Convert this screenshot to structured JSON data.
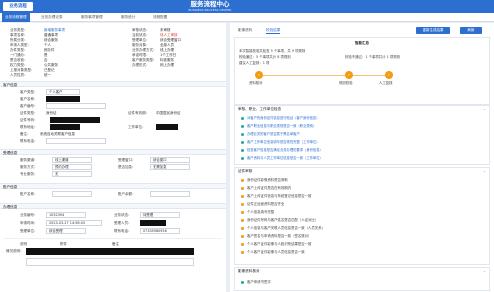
{
  "header": {
    "logo_text": "业务流程",
    "title": "服务流程中心",
    "subtitle": "BUSINESS PROCESS CENTER"
  },
  "tabs": [
    {
      "label": "业务流程管理"
    },
    {
      "label": "业务办理记录"
    },
    {
      "label": "服务事项管理"
    },
    {
      "label": "服务统计"
    },
    {
      "label": "流程配置"
    }
  ],
  "left": {
    "top_fields": [
      {
        "label": "业务类型：",
        "value": "新增服务事项"
      },
      {
        "label": "事项名称：",
        "value": "普通事项"
      },
      {
        "label": "所属分类：",
        "value": "综合服务"
      },
      {
        "label": "受理单位：",
        "value": "综合受理窗口"
      },
      {
        "label": "申请人类型：",
        "value": "个人"
      },
      {
        "label": "服务对象：",
        "value": "全部人员"
      },
      {
        "label": "办件类型：",
        "value": "即办件"
      },
      {
        "label": "业务办理方式：",
        "value": "线上办理"
      },
      {
        "label": "一门通办：",
        "value": "是"
      },
      {
        "label": "承诺时限：",
        "value": "1个工作日"
      },
      {
        "label": "是否收费：",
        "value": "否"
      },
      {
        "label": "客户服务类型：",
        "value": "标准服务"
      },
      {
        "label": "权力类型：",
        "value": "公共服务"
      },
      {
        "label": "办理形式：",
        "value": "网上办理"
      },
      {
        "label": "上报对象类型：",
        "value": "已登记"
      },
      {
        "label": "人员性质：",
        "value": "统一"
      }
    ],
    "status_label": "审核状态：",
    "status_value": "未审核",
    "red_label": "当前状态：",
    "red_value": "待人工审核",
    "section_customer": "客户信息",
    "customer_fields": [
      {
        "label": "客户类型：",
        "value": "个人客户"
      },
      {
        "label": "客户名称：",
        "value": ""
      },
      {
        "label": "客户编号：",
        "value": ""
      },
      {
        "label": "证件类型：",
        "value": "身份证"
      },
      {
        "label": "证件号码：",
        "value": ""
      },
      {
        "label": "联系地址：",
        "value": ""
      },
      {
        "label": "联系电话：",
        "value": ""
      },
      {
        "label": "证件有效期：",
        "value": "中国居民身份证"
      },
      {
        "label": "工作单位：",
        "value": ""
      },
      {
        "label": "备注：",
        "value": "系统自动关联客户信息"
      }
    ],
    "section_handle": "受理信息",
    "handle_fields": [
      {
        "label": "服务渠道：",
        "value": "线上渠道"
      },
      {
        "label": "受理窗口：",
        "value": "综合窗口"
      },
      {
        "label": "服务方式：",
        "value": "预约办理"
      },
      {
        "label": "是否加急：",
        "value": "无需加急"
      },
      {
        "label": "专业服务：",
        "value": "无"
      }
    ],
    "section_account": "账户信息",
    "account_fields": [
      {
        "label": "账户名称：",
        "value": ""
      },
      {
        "label": "账户余额：",
        "value": ""
      }
    ],
    "section_record": "办理信息",
    "record_fields": [
      {
        "label": "业务编号：",
        "value": "1052394"
      },
      {
        "label": "业务状态：",
        "value": "待受理"
      },
      {
        "label": "申请时间：",
        "value": "2023-03-27 14:58:03"
      },
      {
        "label": "受理人员：",
        "value": ""
      },
      {
        "label": "受理单位：",
        "value": "综合受理"
      },
      {
        "label": "联系电话：",
        "value": "07335980556"
      }
    ],
    "footer_fields": [
      {
        "label": "说明",
        "value": ""
      },
      {
        "label": "附件",
        "value": ""
      },
      {
        "label": "备注",
        "value": ""
      }
    ],
    "detail_label": "情况说明：",
    "detail_value": ""
  },
  "right": {
    "tabs": [
      {
        "label": "影像资料"
      },
      {
        "label": "校验结果"
      }
    ],
    "buttons": {
      "primary": "重新生成结果",
      "secondary": "刷新"
    },
    "summary_title": "智能汇总",
    "summary_lines": [
      {
        "text": "本次智能校验共检查 5 个事项，共 9 项规则"
      },
      {
        "text": "校验通过：5 个事项共计 8 项规则"
      },
      {
        "text": "校验不通过：1 个事项共计 1 项规则"
      },
      {
        "text": "建议人工复核：1 项"
      }
    ],
    "steps": [
      {
        "label": "资料核对"
      },
      {
        "label": "规则校验"
      },
      {
        "label": "人工复核"
      }
    ],
    "rules_title": "审核、职业、工作单位检查",
    "rules": [
      {
        "text": "对客户的身份证件信息进行验证（客户身份信息）"
      },
      {
        "text": "客户职业信息与职业类别是否一致（职业类别）"
      },
      {
        "text": "办理业务的客户是否属于黑名单客户"
      },
      {
        "text": "客户工作单位信息填写是否规范完整（工作单位）"
      },
      {
        "text": "检查客户信息是否满足业务办理的要求（身份信息）"
      },
      {
        "text": "客户资料与人员工作单位信息是否一致（工作单位）"
      }
    ],
    "evidence_title": "证件审核",
    "evidence_rules": [
      {
        "text": "身份证件影像资料是否清晰"
      },
      {
        "text": "客户上传证件是否在有效期内"
      },
      {
        "text": "客户上传证件信息与系统登记信息是否一致"
      },
      {
        "text": "证件正反面资料是否齐全"
      },
      {
        "text": "个人信息填写完整"
      },
      {
        "text": "身份证件号码与客户姓名是否匹配（人证对比）"
      },
      {
        "text": "个人信息与客户关联人员信息是否一致（人员关系）"
      },
      {
        "text": "客户签名与申请资料是否一致（签名核对）"
      },
      {
        "text": "个人客户证件影像与人脸识别结果是否一致"
      },
      {
        "text": "个人客户证件影像与人员信息是否一致"
      }
    ],
    "remark_title": "影像资料核对",
    "remark_rules": [
      {
        "text": "客户申请书签字"
      }
    ]
  },
  "colors": {
    "brand": "#2c6fd0",
    "accent_orange": "#f39c12",
    "check_teal": "#2aa6a0",
    "error_red": "#e53935"
  }
}
